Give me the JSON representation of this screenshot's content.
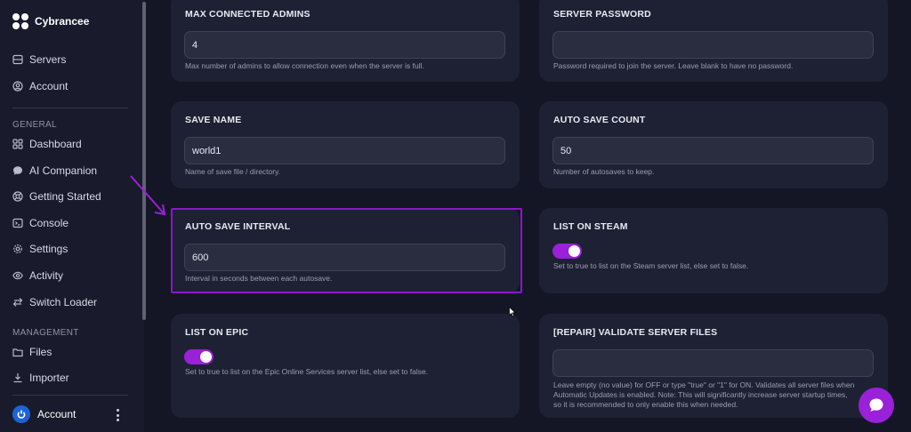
{
  "brand": {
    "name": "Cybrancee"
  },
  "nav_top": [
    {
      "label": "Servers",
      "icon": "server-icon"
    },
    {
      "label": "Account",
      "icon": "user-circle-icon"
    }
  ],
  "sections": {
    "general": "GENERAL",
    "management": "MANAGEMENT"
  },
  "nav_general": [
    {
      "label": "Dashboard",
      "icon": "dashboard-icon"
    },
    {
      "label": "AI Companion",
      "icon": "chat-bubble-icon"
    },
    {
      "label": "Getting Started",
      "icon": "lifebuoy-icon"
    },
    {
      "label": "Console",
      "icon": "terminal-icon"
    },
    {
      "label": "Settings",
      "icon": "gear-icon"
    },
    {
      "label": "Activity",
      "icon": "eye-icon"
    },
    {
      "label": "Switch Loader",
      "icon": "swap-arrows-icon"
    }
  ],
  "nav_management": [
    {
      "label": "Files",
      "icon": "folder-icon"
    },
    {
      "label": "Importer",
      "icon": "download-icon"
    }
  ],
  "account_bottom": {
    "label": "Account"
  },
  "cards": {
    "max_admins": {
      "title": "MAX CONNECTED ADMINS",
      "value": "4",
      "help": "Max number of admins to allow connection even when the server is full."
    },
    "server_password": {
      "title": "SERVER PASSWORD",
      "value": "",
      "help": "Password required to join the server. Leave blank to have no password."
    },
    "save_name": {
      "title": "SAVE NAME",
      "value": "world1",
      "help": "Name of save file / directory."
    },
    "auto_save_count": {
      "title": "AUTO SAVE COUNT",
      "value": "50",
      "help": "Number of autosaves to keep."
    },
    "auto_save_interval": {
      "title": "AUTO SAVE INTERVAL",
      "value": "600",
      "help": "Interval in seconds between each autosave."
    },
    "list_on_steam": {
      "title": "LIST ON STEAM",
      "enabled": true,
      "help": "Set to true to list on the Steam server list, else set to false."
    },
    "list_on_epic": {
      "title": "LIST ON EPIC",
      "enabled": true,
      "help": "Set to true to list on the Epic Online Services server list, else set to false."
    },
    "validate_files": {
      "title": "[REPAIR] VALIDATE SERVER FILES",
      "value": "",
      "help_lines": [
        "Leave empty (no value) for OFF or type \"true\" or \"1\" for ON. Validates all server files when",
        "Automatic Updates is enabled. Note: This will significantly increase server startup times,",
        "so it is recommended to only enable this when needed."
      ]
    }
  },
  "colors": {
    "accent": "#9b20d9",
    "highlight": "#8c17c9",
    "background": "#141625",
    "card": "#1e2133"
  }
}
